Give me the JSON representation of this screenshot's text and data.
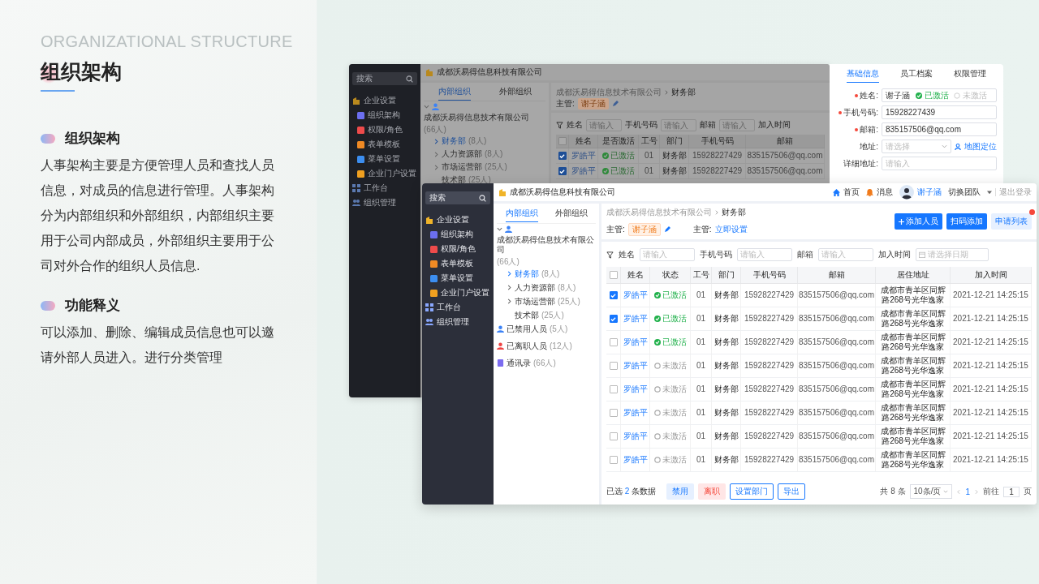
{
  "slide": {
    "subtitle": "ORGANIZATIONAL STRUCTURE",
    "title": "组织架构",
    "sections": [
      {
        "heading": "组织架构",
        "text": "人事架构主要是方便管理人员和查找人员信息，对成员的信息进行管理。人事架构分为内部组织和外部组织，内部组织主要用于公司内部成员，外部组织主要用于公司对外合作的组织人员信息."
      },
      {
        "heading": "功能释义",
        "text": "可以添加、删除、编辑成员信息也可以邀请外部人员进入。进行分类管理"
      }
    ]
  },
  "back_window": {
    "company": "成都沃易得信息科技有限公司",
    "sidebar": {
      "search_placeholder": "搜索",
      "groups": [
        {
          "label": "企业设置",
          "children": [
            {
              "label": "组织架构",
              "color": "#6c6ff0"
            },
            {
              "label": "权限/角色",
              "color": "#ef4b4b"
            },
            {
              "label": "表单模板",
              "color": "#f08a24"
            },
            {
              "label": "菜单设置",
              "color": "#3c8ef0"
            },
            {
              "label": "企业门户设置",
              "color": "#f0a020"
            }
          ]
        },
        {
          "label": "工作台"
        },
        {
          "label": "组织管理"
        }
      ]
    },
    "tabs": [
      {
        "label": "内部组织",
        "selected": true
      },
      {
        "label": "外部组织",
        "selected": false
      }
    ],
    "tree": [
      {
        "label": "成都沃易得信息技术有限公司",
        "count": "(66人)",
        "color": "#3b82f6",
        "expanded": true,
        "selected": false,
        "children": [
          {
            "label": "财务部",
            "count": "(8人)",
            "expanded": false,
            "selected": true
          },
          {
            "label": "人力资源部",
            "count": "(8人)",
            "expanded": false,
            "selected": false
          },
          {
            "label": "市场运营部",
            "count": "(25人)",
            "expanded": false,
            "selected": false
          },
          {
            "label": "技术部",
            "count": "(25人)",
            "selected": false
          }
        ]
      }
    ],
    "breadcrumb": [
      "成都沃易得信息技术有限公司",
      "财务部"
    ],
    "managers": [
      {
        "kind": "tag",
        "label": "主管:",
        "value": "谢子涵"
      }
    ],
    "filters": [
      {
        "label": "姓名",
        "placeholder": "请输入",
        "kind": "text"
      },
      {
        "label": "手机号码",
        "placeholder": "请输入",
        "kind": "text"
      },
      {
        "label": "邮箱",
        "placeholder": "请输入",
        "kind": "text"
      },
      {
        "label": "加入时间"
      }
    ],
    "table": {
      "all_checked": false,
      "columns": [
        "姓名",
        "是否激活",
        "工号",
        "部门",
        "手机号码",
        "邮箱"
      ],
      "rows": [
        {
          "checked": true,
          "name": "罗皓平",
          "status": "已激活",
          "active": true,
          "id": "01",
          "dept": "财务部",
          "phone": "15928227429",
          "email": "835157506@qq.com"
        },
        {
          "checked": true,
          "name": "罗皓平",
          "status": "已激活",
          "active": true,
          "id": "01",
          "dept": "财务部",
          "phone": "15928227429",
          "email": "835157506@qq.com"
        }
      ]
    }
  },
  "drawer": {
    "tabs": [
      {
        "label": "基础信息",
        "selected": true
      },
      {
        "label": "员工档案",
        "selected": false
      },
      {
        "label": "权限管理",
        "selected": false
      }
    ],
    "fields": [
      {
        "kind": "text",
        "label": "姓名:",
        "required": true,
        "value": "谢子涵",
        "options": [
          {
            "label": "已激活",
            "selected": true
          },
          {
            "label": "未激活",
            "selected": false
          }
        ]
      },
      {
        "kind": "text",
        "label": "手机号码:",
        "required": true,
        "value": "15928227439"
      },
      {
        "kind": "text",
        "label": "邮箱:",
        "required": true,
        "value": "835157506@qq.com"
      },
      {
        "kind": "select",
        "label": "地址:",
        "required": false,
        "placeholder": "请选择",
        "link": "地图定位"
      },
      {
        "kind": "text",
        "label": "详细地址:",
        "required": false,
        "placeholder": "请输入"
      }
    ]
  },
  "front_window": {
    "company": "成都沃易得信息科技有限公司",
    "nav": [
      {
        "label": "首页"
      },
      {
        "label": "消息"
      }
    ],
    "user": "谢子涵",
    "team": "切换团队",
    "logout": "退出登录",
    "sidebar": {
      "search_placeholder": "搜索",
      "groups": [
        {
          "label": "企业设置",
          "children": [
            {
              "label": "组织架构",
              "color": "#6c6ff0"
            },
            {
              "label": "权限/角色",
              "color": "#ef4b4b"
            },
            {
              "label": "表单模板",
              "color": "#f08a24"
            },
            {
              "label": "菜单设置",
              "color": "#3c8ef0"
            },
            {
              "label": "企业门户设置",
              "color": "#f0a020"
            }
          ]
        },
        {
          "label": "工作台"
        },
        {
          "label": "组织管理"
        }
      ]
    },
    "tabs": [
      {
        "label": "内部组织",
        "selected": true
      },
      {
        "label": "外部组织",
        "selected": false
      }
    ],
    "tree": [
      {
        "label": "成都沃易得信息技术有限公司",
        "count": "(66人)",
        "color": "#3b82f6",
        "expanded": true,
        "selected": false,
        "children": [
          {
            "label": "财务部",
            "count": "(8人)",
            "expanded": false,
            "selected": true
          },
          {
            "label": "人力资源部",
            "count": "(8人)",
            "expanded": false,
            "selected": false
          },
          {
            "label": "市场运营部",
            "count": "(25人)",
            "expanded": false,
            "selected": false
          },
          {
            "label": "技术部",
            "count": "(25人)",
            "selected": false
          }
        ]
      },
      {
        "label": "已禁用人员",
        "count": "(5人)",
        "color": "#3b82f6",
        "selected": false
      },
      {
        "label": "已离职人员",
        "count": "(12人)",
        "color": "#ef4444",
        "selected": false
      },
      {
        "label": "通讯录",
        "count": "(66人)",
        "color": "#7c6cf0",
        "selected": false
      }
    ],
    "breadcrumb": [
      "成都沃易得信息技术有限公司",
      "财务部"
    ],
    "managers": [
      {
        "kind": "tag",
        "label": "主管:",
        "value": "谢子涵"
      },
      {
        "kind": "link",
        "label": "主管:",
        "value": "立即设置"
      }
    ],
    "actions": [
      {
        "label": "添加人员",
        "kind": "primary",
        "plus": true,
        "badge": false
      },
      {
        "label": "扫码添加",
        "kind": "primary",
        "plus": false,
        "badge": false
      },
      {
        "label": "申请列表",
        "kind": "light",
        "plus": false,
        "badge": true
      }
    ],
    "filters": [
      {
        "label": "姓名",
        "placeholder": "请输入",
        "kind": "text"
      },
      {
        "label": "手机号码",
        "placeholder": "请输入",
        "kind": "text"
      },
      {
        "label": "邮箱",
        "placeholder": "请输入",
        "kind": "text"
      },
      {
        "label": "加入时间",
        "placeholder": "请选择日期",
        "kind": "date"
      }
    ],
    "table": {
      "all_checked": false,
      "columns": [
        "姓名",
        "状态",
        "工号",
        "部门",
        "手机号码",
        "邮箱",
        "居住地址",
        "加入时间"
      ],
      "rows": [
        {
          "checked": true,
          "name": "罗皓平",
          "status": "已激活",
          "active": true,
          "id": "01",
          "dept": "财务部",
          "phone": "15928227429",
          "email": "835157506@qq.com",
          "address": "成都市青羊区同辉路268号光华逸家",
          "joined": "2021-12-21 14:25:15"
        },
        {
          "checked": true,
          "name": "罗皓平",
          "status": "已激活",
          "active": true,
          "id": "01",
          "dept": "财务部",
          "phone": "15928227429",
          "email": "835157506@qq.com",
          "address": "成都市青羊区同辉路268号光华逸家",
          "joined": "2021-12-21 14:25:15"
        },
        {
          "checked": false,
          "name": "罗皓平",
          "status": "已激活",
          "active": true,
          "id": "01",
          "dept": "财务部",
          "phone": "15928227429",
          "email": "835157506@qq.com",
          "address": "成都市青羊区同辉路268号光华逸家",
          "joined": "2021-12-21 14:25:15"
        },
        {
          "checked": false,
          "name": "罗皓平",
          "status": "未激活",
          "active": false,
          "id": "01",
          "dept": "财务部",
          "phone": "15928227429",
          "email": "835157506@qq.com",
          "address": "成都市青羊区同辉路268号光华逸家",
          "joined": "2021-12-21 14:25:15"
        },
        {
          "checked": false,
          "name": "罗皓平",
          "status": "未激活",
          "active": false,
          "id": "01",
          "dept": "财务部",
          "phone": "15928227429",
          "email": "835157506@qq.com",
          "address": "成都市青羊区同辉路268号光华逸家",
          "joined": "2021-12-21 14:25:15"
        },
        {
          "checked": false,
          "name": "罗皓平",
          "status": "未激活",
          "active": false,
          "id": "01",
          "dept": "财务部",
          "phone": "15928227429",
          "email": "835157506@qq.com",
          "address": "成都市青羊区同辉路268号光华逸家",
          "joined": "2021-12-21 14:25:15"
        },
        {
          "checked": false,
          "name": "罗皓平",
          "status": "未激活",
          "active": false,
          "id": "01",
          "dept": "财务部",
          "phone": "15928227429",
          "email": "835157506@qq.com",
          "address": "成都市青羊区同辉路268号光华逸家",
          "joined": "2021-12-21 14:25:15"
        },
        {
          "checked": false,
          "name": "罗皓平",
          "status": "未激活",
          "active": false,
          "id": "01",
          "dept": "财务部",
          "phone": "15928227429",
          "email": "835157506@qq.com",
          "address": "成都市青羊区同辉路268号光华逸家",
          "joined": "2021-12-21 14:25:15"
        }
      ]
    },
    "footer": {
      "selected_prefix": "已选",
      "selected_count": "2",
      "selected_suffix": "条数据",
      "buttons": [
        {
          "label": "禁用",
          "kind": "blue"
        },
        {
          "label": "离职",
          "kind": "red"
        },
        {
          "label": "设置部门",
          "kind": "outline"
        },
        {
          "label": "导出",
          "kind": "outline"
        }
      ],
      "total": "共 8 条",
      "page_size": "10条/页",
      "pages": [
        {
          "label": "1",
          "selected": true
        }
      ],
      "goto": "前往",
      "goto_value": "1",
      "goto_suffix": "页"
    }
  }
}
